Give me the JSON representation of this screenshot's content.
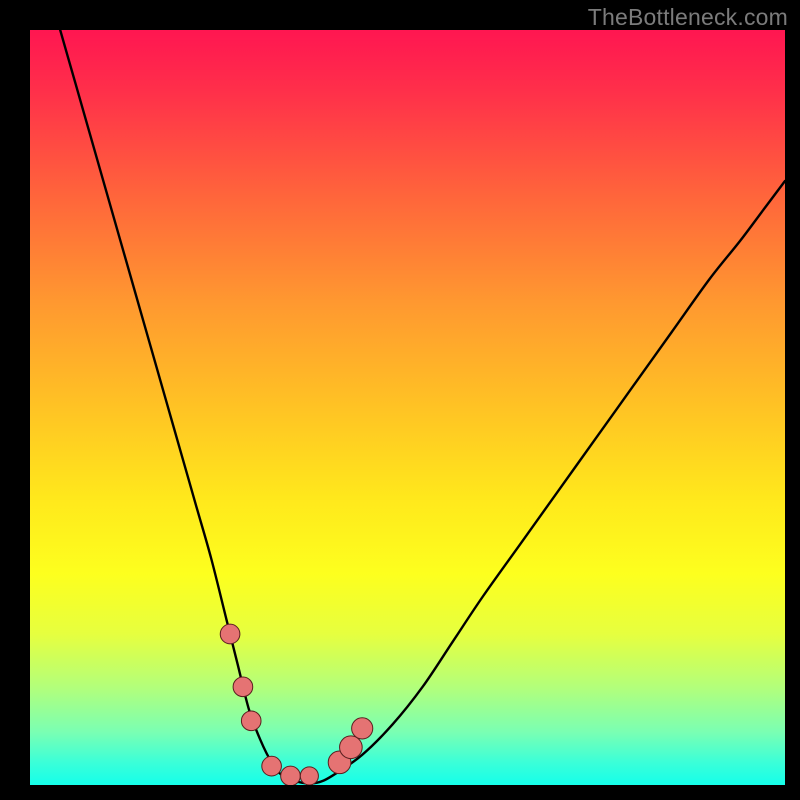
{
  "watermark": "TheBottleneck.com",
  "chart_data": {
    "type": "line",
    "title": "",
    "xlabel": "",
    "ylabel": "",
    "xlim": [
      0,
      100
    ],
    "ylim": [
      0,
      100
    ],
    "series": [
      {
        "name": "bottleneck-curve",
        "x": [
          4,
          6,
          8,
          10,
          12,
          14,
          16,
          18,
          20,
          22,
          24,
          26,
          27.5,
          29,
          30.5,
          32,
          33.5,
          36,
          38,
          40,
          44,
          48,
          52,
          56,
          60,
          65,
          70,
          75,
          80,
          85,
          90,
          94,
          97,
          100
        ],
        "y": [
          100,
          93,
          86,
          79,
          72,
          65,
          58,
          51,
          44,
          37,
          30,
          22,
          16,
          10,
          6,
          3,
          1.2,
          0.3,
          0.3,
          1.2,
          4,
          8,
          13,
          19,
          25,
          32,
          39,
          46,
          53,
          60,
          67,
          72,
          76,
          80
        ]
      }
    ],
    "markers": [
      {
        "name": "marker-left-1",
        "x": 26.5,
        "y": 20,
        "r": 1.3
      },
      {
        "name": "marker-left-2",
        "x": 28.2,
        "y": 13,
        "r": 1.3
      },
      {
        "name": "marker-left-3",
        "x": 29.3,
        "y": 8.5,
        "r": 1.3
      },
      {
        "name": "marker-bottom-1",
        "x": 32,
        "y": 2.5,
        "r": 1.3
      },
      {
        "name": "marker-bottom-2",
        "x": 34.5,
        "y": 1.2,
        "r": 1.3
      },
      {
        "name": "marker-bottom-3",
        "x": 37,
        "y": 1.2,
        "r": 1.2
      },
      {
        "name": "marker-right-1",
        "x": 41,
        "y": 3,
        "r": 1.5
      },
      {
        "name": "marker-right-2",
        "x": 42.5,
        "y": 5,
        "r": 1.5
      },
      {
        "name": "marker-right-3",
        "x": 44,
        "y": 7.5,
        "r": 1.4
      }
    ],
    "colors": {
      "curve_stroke": "#000000",
      "marker_fill": "#e57373",
      "marker_stroke": "#5a1f1f"
    }
  }
}
